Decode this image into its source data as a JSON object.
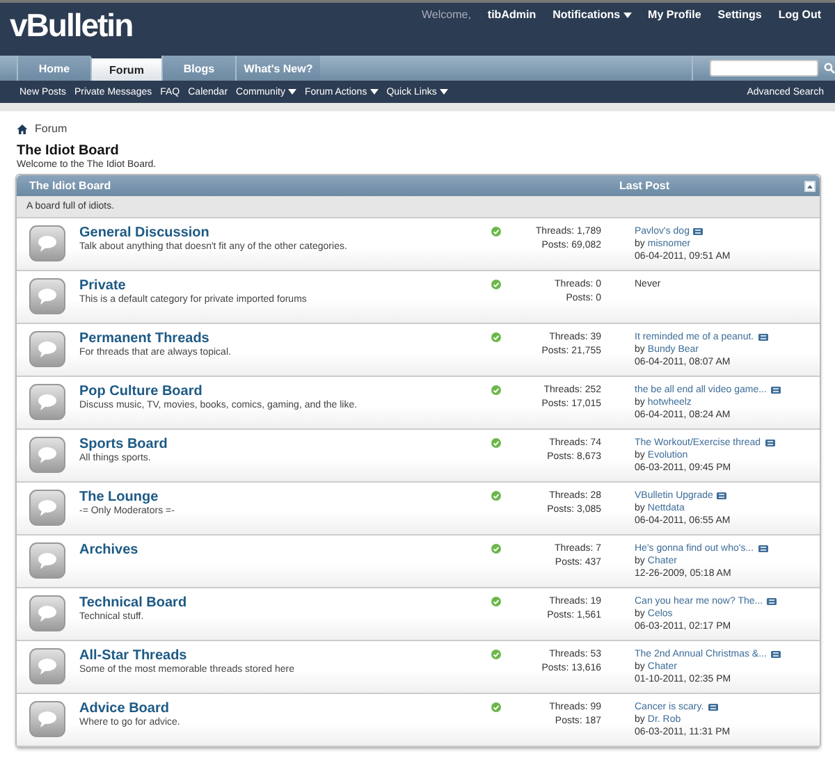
{
  "header": {
    "logo": "vBulletin",
    "welcome": "Welcome,",
    "username": "tibAdmin",
    "links": [
      {
        "label": "Notifications",
        "has_menu": true
      },
      {
        "label": "My Profile",
        "has_menu": false
      },
      {
        "label": "Settings",
        "has_menu": false
      },
      {
        "label": "Log Out",
        "has_menu": false
      }
    ]
  },
  "tabs": [
    {
      "label": "Home",
      "selected": false
    },
    {
      "label": "Forum",
      "selected": true
    },
    {
      "label": "Blogs",
      "selected": false
    },
    {
      "label": "What's New?",
      "selected": false
    }
  ],
  "subnav": [
    {
      "label": "New Posts",
      "has_menu": false
    },
    {
      "label": "Private Messages",
      "has_menu": false
    },
    {
      "label": "FAQ",
      "has_menu": false
    },
    {
      "label": "Calendar",
      "has_menu": false
    },
    {
      "label": "Community",
      "has_menu": true
    },
    {
      "label": "Forum Actions",
      "has_menu": true
    },
    {
      "label": "Quick Links",
      "has_menu": true
    }
  ],
  "advanced_search": "Advanced Search",
  "breadcrumb": "Forum",
  "page_title": "The Idiot Board",
  "page_subtitle": "Welcome to the The Idiot Board.",
  "board": {
    "title": "The Idiot Board",
    "last_post_heading": "Last Post",
    "description": "A board full of idiots.",
    "forums": [
      {
        "name": "General Discussion",
        "description": "Talk about anything that doesn't fit any of the other categories.",
        "threads": "Threads: 1,789",
        "posts": "Posts: 69,082",
        "last_post": {
          "kind": "post",
          "title": "Pavlov's dog",
          "by": "by",
          "user": "misnomer",
          "date": "06-04-2011, 09:51 AM"
        }
      },
      {
        "name": "Private",
        "description": "This is a default category for private imported forums",
        "threads": "Threads: 0",
        "posts": "Posts: 0",
        "last_post": {
          "kind": "never",
          "title": "Never"
        }
      },
      {
        "name": "Permanent Threads",
        "description": "For threads that are always topical.",
        "threads": "Threads: 39",
        "posts": "Posts: 21,755",
        "last_post": {
          "kind": "post",
          "title": "It reminded me of a peanut.",
          "by": "by",
          "user": "Bundy Bear",
          "date": "06-04-2011, 08:07 AM"
        }
      },
      {
        "name": "Pop Culture Board",
        "description": "Discuss music, TV, movies, books, comics, gaming, and the like.",
        "threads": "Threads: 252",
        "posts": "Posts: 17,015",
        "last_post": {
          "kind": "post",
          "title": "the be all end all video game...",
          "by": "by",
          "user": "hotwheelz",
          "date": "06-04-2011, 08:24 AM"
        }
      },
      {
        "name": "Sports Board",
        "description": "All things sports.",
        "threads": "Threads: 74",
        "posts": "Posts: 8,673",
        "last_post": {
          "kind": "post",
          "title": "The Workout/Exercise thread",
          "by": "by",
          "user": "Evolution",
          "date": "06-03-2011, 09:45 PM"
        }
      },
      {
        "name": "The Lounge",
        "description": "-= Only Moderators =-",
        "threads": "Threads: 28",
        "posts": "Posts: 3,085",
        "last_post": {
          "kind": "post",
          "title": "VBulletin Upgrade",
          "by": "by",
          "user": "Nettdata",
          "date": "06-04-2011, 06:55 AM"
        }
      },
      {
        "name": "Archives",
        "threads": "Threads: 7",
        "posts": "Posts: 437",
        "last_post": {
          "kind": "post",
          "title": "He's gonna find out who's...",
          "by": "by",
          "user": "Chater",
          "date": "12-26-2009, 05:18 AM"
        }
      },
      {
        "name": "Technical Board",
        "description": "Technical stuff.",
        "threads": "Threads: 19",
        "posts": "Posts: 1,561",
        "last_post": {
          "kind": "post",
          "title": "Can you hear me now? The...",
          "by": "by",
          "user": "Celos",
          "date": "06-03-2011, 02:17 PM"
        }
      },
      {
        "name": "All-Star Threads",
        "description": "Some of the most memorable threads stored here",
        "threads": "Threads: 53",
        "posts": "Posts: 13,616",
        "last_post": {
          "kind": "post",
          "title": "The 2nd Annual Christmas &...",
          "by": "by",
          "user": "Chater",
          "date": "01-10-2011, 02:35 PM"
        }
      },
      {
        "name": "Advice Board",
        "description": "Where to go for advice.",
        "threads": "Threads: 99",
        "posts": "Posts: 187",
        "last_post": {
          "kind": "post",
          "title": "Cancer is scary.",
          "by": "by",
          "user": "Dr. Rob",
          "date": "06-03-2011, 11:31 PM"
        }
      }
    ]
  }
}
